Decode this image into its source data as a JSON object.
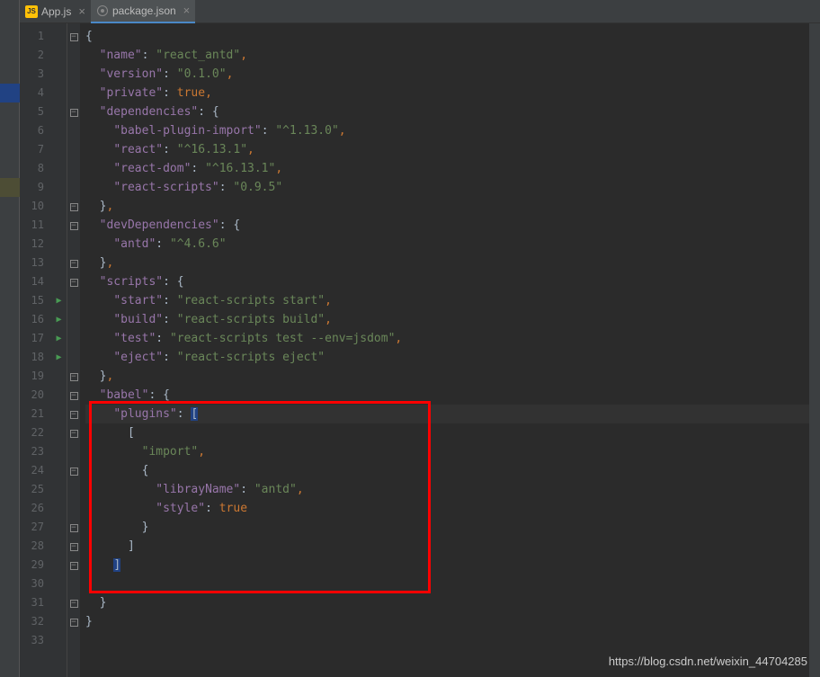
{
  "tabs": [
    {
      "name": "App.js",
      "iconType": "js",
      "active": false
    },
    {
      "name": "package.json",
      "iconType": "json",
      "active": true
    }
  ],
  "currentLine": 21,
  "highlightBox": {
    "startLine": 21,
    "endLine": 30
  },
  "runMarkers": [
    15,
    16,
    17,
    18
  ],
  "gutterMarks": [
    {
      "line": 4,
      "color": "#214283"
    },
    {
      "line": 9,
      "color": "#4d4d35"
    }
  ],
  "watermark": "https://blog.csdn.net/weixin_44704285",
  "code": [
    {
      "n": 1,
      "fold": "-",
      "indent": 0,
      "tokens": [
        [
          "p",
          "{"
        ]
      ]
    },
    {
      "n": 2,
      "indent": 1,
      "tokens": [
        [
          "k",
          "\"name\""
        ],
        [
          "p",
          ": "
        ],
        [
          "s",
          "\"react_antd\""
        ],
        [
          "c",
          ","
        ]
      ]
    },
    {
      "n": 3,
      "indent": 1,
      "tokens": [
        [
          "k",
          "\"version\""
        ],
        [
          "p",
          ": "
        ],
        [
          "s",
          "\"0.1.0\""
        ],
        [
          "c",
          ","
        ]
      ]
    },
    {
      "n": 4,
      "indent": 1,
      "tokens": [
        [
          "k",
          "\"private\""
        ],
        [
          "p",
          ": "
        ],
        [
          "b",
          "true"
        ],
        [
          "c",
          ","
        ]
      ]
    },
    {
      "n": 5,
      "fold": "-",
      "indent": 1,
      "tokens": [
        [
          "k",
          "\"dependencies\""
        ],
        [
          "p",
          ": {"
        ]
      ]
    },
    {
      "n": 6,
      "indent": 2,
      "tokens": [
        [
          "k",
          "\"babel-plugin-import\""
        ],
        [
          "p",
          ": "
        ],
        [
          "s",
          "\"^1.13.0\""
        ],
        [
          "c",
          ","
        ]
      ]
    },
    {
      "n": 7,
      "indent": 2,
      "tokens": [
        [
          "k",
          "\"react\""
        ],
        [
          "p",
          ": "
        ],
        [
          "s",
          "\"^16.13.1\""
        ],
        [
          "c",
          ","
        ]
      ]
    },
    {
      "n": 8,
      "indent": 2,
      "tokens": [
        [
          "k",
          "\"react-dom\""
        ],
        [
          "p",
          ": "
        ],
        [
          "s",
          "\"^16.13.1\""
        ],
        [
          "c",
          ","
        ]
      ]
    },
    {
      "n": 9,
      "indent": 2,
      "tokens": [
        [
          "k",
          "\"react-scripts\""
        ],
        [
          "p",
          ": "
        ],
        [
          "s",
          "\"0.9.5\""
        ]
      ]
    },
    {
      "n": 10,
      "fold": "-",
      "indent": 1,
      "tokens": [
        [
          "p",
          "}"
        ],
        [
          "c",
          ","
        ]
      ]
    },
    {
      "n": 11,
      "fold": "-",
      "indent": 1,
      "tokens": [
        [
          "k",
          "\"devDependencies\""
        ],
        [
          "p",
          ": {"
        ]
      ]
    },
    {
      "n": 12,
      "indent": 2,
      "tokens": [
        [
          "k",
          "\"antd\""
        ],
        [
          "p",
          ": "
        ],
        [
          "s",
          "\"^4.6.6\""
        ]
      ]
    },
    {
      "n": 13,
      "fold": "-",
      "indent": 1,
      "tokens": [
        [
          "p",
          "}"
        ],
        [
          "c",
          ","
        ]
      ]
    },
    {
      "n": 14,
      "fold": "-",
      "indent": 1,
      "tokens": [
        [
          "k",
          "\"scripts\""
        ],
        [
          "p",
          ": {"
        ]
      ]
    },
    {
      "n": 15,
      "indent": 2,
      "tokens": [
        [
          "k",
          "\"start\""
        ],
        [
          "p",
          ": "
        ],
        [
          "s",
          "\"react-scripts start\""
        ],
        [
          "c",
          ","
        ]
      ]
    },
    {
      "n": 16,
      "indent": 2,
      "tokens": [
        [
          "k",
          "\"build\""
        ],
        [
          "p",
          ": "
        ],
        [
          "s",
          "\"react-scripts build\""
        ],
        [
          "c",
          ","
        ]
      ]
    },
    {
      "n": 17,
      "indent": 2,
      "tokens": [
        [
          "k",
          "\"test\""
        ],
        [
          "p",
          ": "
        ],
        [
          "s",
          "\"react-scripts test --env=jsdom\""
        ],
        [
          "c",
          ","
        ]
      ]
    },
    {
      "n": 18,
      "indent": 2,
      "tokens": [
        [
          "k",
          "\"eject\""
        ],
        [
          "p",
          ": "
        ],
        [
          "s",
          "\"react-scripts eject\""
        ]
      ]
    },
    {
      "n": 19,
      "fold": "-",
      "indent": 1,
      "tokens": [
        [
          "p",
          "}"
        ],
        [
          "c",
          ","
        ]
      ]
    },
    {
      "n": 20,
      "fold": "-",
      "indent": 1,
      "tokens": [
        [
          "k",
          "\"babel\""
        ],
        [
          "p",
          ": {"
        ]
      ]
    },
    {
      "n": 21,
      "fold": "-",
      "indent": 2,
      "tokens": [
        [
          "k",
          "\"plugins\""
        ],
        [
          "p",
          ": "
        ],
        [
          "bm",
          "["
        ]
      ]
    },
    {
      "n": 22,
      "fold": "-",
      "indent": 3,
      "tokens": [
        [
          "p",
          "["
        ]
      ]
    },
    {
      "n": 23,
      "indent": 4,
      "tokens": [
        [
          "s",
          "\"import\""
        ],
        [
          "c",
          ","
        ]
      ]
    },
    {
      "n": 24,
      "fold": "-",
      "indent": 4,
      "tokens": [
        [
          "p",
          "{"
        ]
      ]
    },
    {
      "n": 25,
      "indent": 5,
      "tokens": [
        [
          "k",
          "\"librayName\""
        ],
        [
          "p",
          ": "
        ],
        [
          "s",
          "\"antd\""
        ],
        [
          "c",
          ","
        ]
      ]
    },
    {
      "n": 26,
      "indent": 5,
      "tokens": [
        [
          "k",
          "\"style\""
        ],
        [
          "p",
          ": "
        ],
        [
          "b",
          "true"
        ]
      ]
    },
    {
      "n": 27,
      "fold": "-",
      "indent": 4,
      "tokens": [
        [
          "p",
          "}"
        ]
      ]
    },
    {
      "n": 28,
      "fold": "-",
      "indent": 3,
      "tokens": [
        [
          "p",
          "]"
        ]
      ]
    },
    {
      "n": 29,
      "fold": "-",
      "indent": 2,
      "tokens": [
        [
          "bm",
          "]"
        ]
      ]
    },
    {
      "n": 30,
      "indent": 0,
      "tokens": []
    },
    {
      "n": 31,
      "fold": "-",
      "indent": 1,
      "tokens": [
        [
          "p",
          "}"
        ]
      ]
    },
    {
      "n": 32,
      "fold": "-",
      "indent": 0,
      "tokens": [
        [
          "p",
          "}"
        ]
      ]
    },
    {
      "n": 33,
      "indent": 0,
      "tokens": []
    }
  ]
}
